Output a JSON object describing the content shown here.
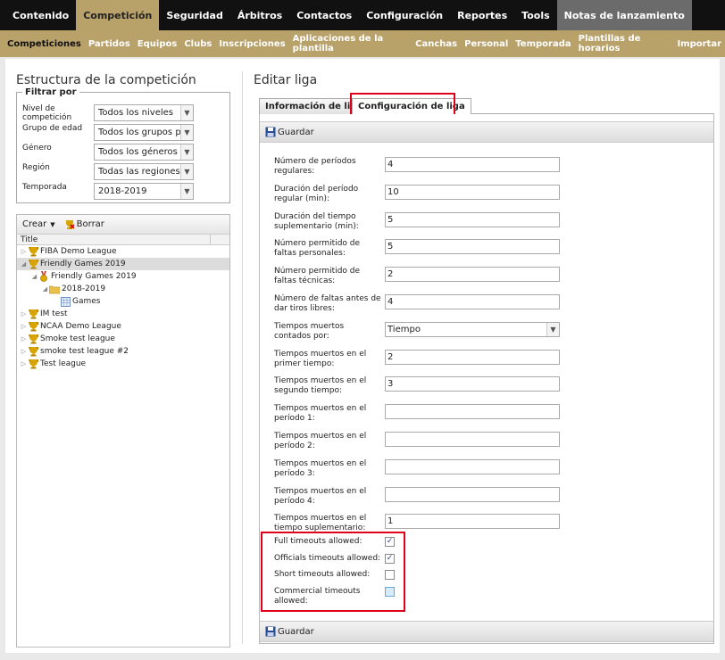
{
  "topnav": [
    "Contenido",
    "Competición",
    "Seguridad",
    "Árbitros",
    "Contactos",
    "Configuración",
    "Reportes",
    "Tools",
    "Notas de lanzamiento"
  ],
  "subnav": [
    "Competiciones",
    "Partidos",
    "Equipos",
    "Clubs",
    "Inscripciones",
    "Aplicaciones de la plantilla",
    "Canchas",
    "Personal",
    "Temporada",
    "Plantillas de horarios",
    "Importar"
  ],
  "left": {
    "title": "Estructura de la competición",
    "filter": {
      "legend": "Filtrar por",
      "rows": [
        {
          "label": "Nivel de competición",
          "value": "Todos los niveles"
        },
        {
          "label": "Grupo de edad",
          "value": "Todos los grupos por"
        },
        {
          "label": "Género",
          "value": "Todos los géneros"
        },
        {
          "label": "Región",
          "value": "Todas las regiones"
        },
        {
          "label": "Temporada",
          "value": "2018-2019"
        }
      ]
    },
    "tree": {
      "create": "Crear",
      "delete": "Borrar",
      "column": "Title",
      "nodes": [
        {
          "label": "FIBA Demo League",
          "icon": "trophy-icon",
          "level": 0,
          "toggle": "▷"
        },
        {
          "label": "Friendly Games 2019",
          "icon": "trophy-icon",
          "level": 0,
          "toggle": "◢"
        },
        {
          "label": "Friendly Games 2019",
          "icon": "medal-icon",
          "level": 1,
          "toggle": "◢"
        },
        {
          "label": "2018-2019",
          "icon": "folder-icon",
          "level": 2,
          "toggle": "◢"
        },
        {
          "label": "Games",
          "icon": "calendar-grid-icon",
          "level": 3,
          "toggle": ""
        },
        {
          "label": "IM test",
          "icon": "trophy-icon",
          "level": 0,
          "toggle": "▷"
        },
        {
          "label": "NCAA Demo League",
          "icon": "trophy-icon",
          "level": 0,
          "toggle": "▷"
        },
        {
          "label": "Smoke test league",
          "icon": "trophy-icon",
          "level": 0,
          "toggle": "▷"
        },
        {
          "label": "smoke test league #2",
          "icon": "trophy-icon",
          "level": 0,
          "toggle": "▷"
        },
        {
          "label": "Test league",
          "icon": "trophy-icon",
          "level": 0,
          "toggle": "▷"
        }
      ]
    }
  },
  "right": {
    "title": "Editar liga",
    "tabs": [
      "Información de liga",
      "Configuración de liga"
    ],
    "save": "Guardar",
    "fields": [
      {
        "label": "Número de períodos regulares:",
        "value": "4"
      },
      {
        "label": "Duración del período regular (min):",
        "value": "10"
      },
      {
        "label": "Duración del tiempo suplementario (min):",
        "value": "5"
      },
      {
        "label": "Número permitido de faltas personales:",
        "value": "5"
      },
      {
        "label": "Número permitido de faltas técnicas:",
        "value": "2"
      },
      {
        "label": "Número de faltas antes de dar tiros libres:",
        "value": "4"
      },
      {
        "label": "Tiempos muertos contados por:",
        "value": "Tiempo"
      },
      {
        "label": "Tiempos muertos en el primer tiempo:",
        "value": "2"
      },
      {
        "label": "Tiempos muertos en el segundo tiempo:",
        "value": "3"
      },
      {
        "label": "Tiempos muertos en el período 1:",
        "value": ""
      },
      {
        "label": "Tiempos muertos en el período 2:",
        "value": ""
      },
      {
        "label": "Tiempos muertos en el período 3:",
        "value": ""
      },
      {
        "label": "Tiempos muertos en el período 4:",
        "value": ""
      },
      {
        "label": "Tiempos muertos en el tiempo suplementario:",
        "value": "1"
      }
    ],
    "checks": [
      {
        "label": "Full timeouts allowed:",
        "checked": true
      },
      {
        "label": "Officials timeouts allowed:",
        "checked": true
      },
      {
        "label": "Short timeouts allowed:",
        "checked": false
      },
      {
        "label": "Commercial timeouts allowed:",
        "checked": false
      }
    ]
  },
  "colors": {
    "accent": "#b9a16a",
    "nav_bg": "#111111",
    "highlight": "#e0001a",
    "trophy": "#d9a400"
  }
}
